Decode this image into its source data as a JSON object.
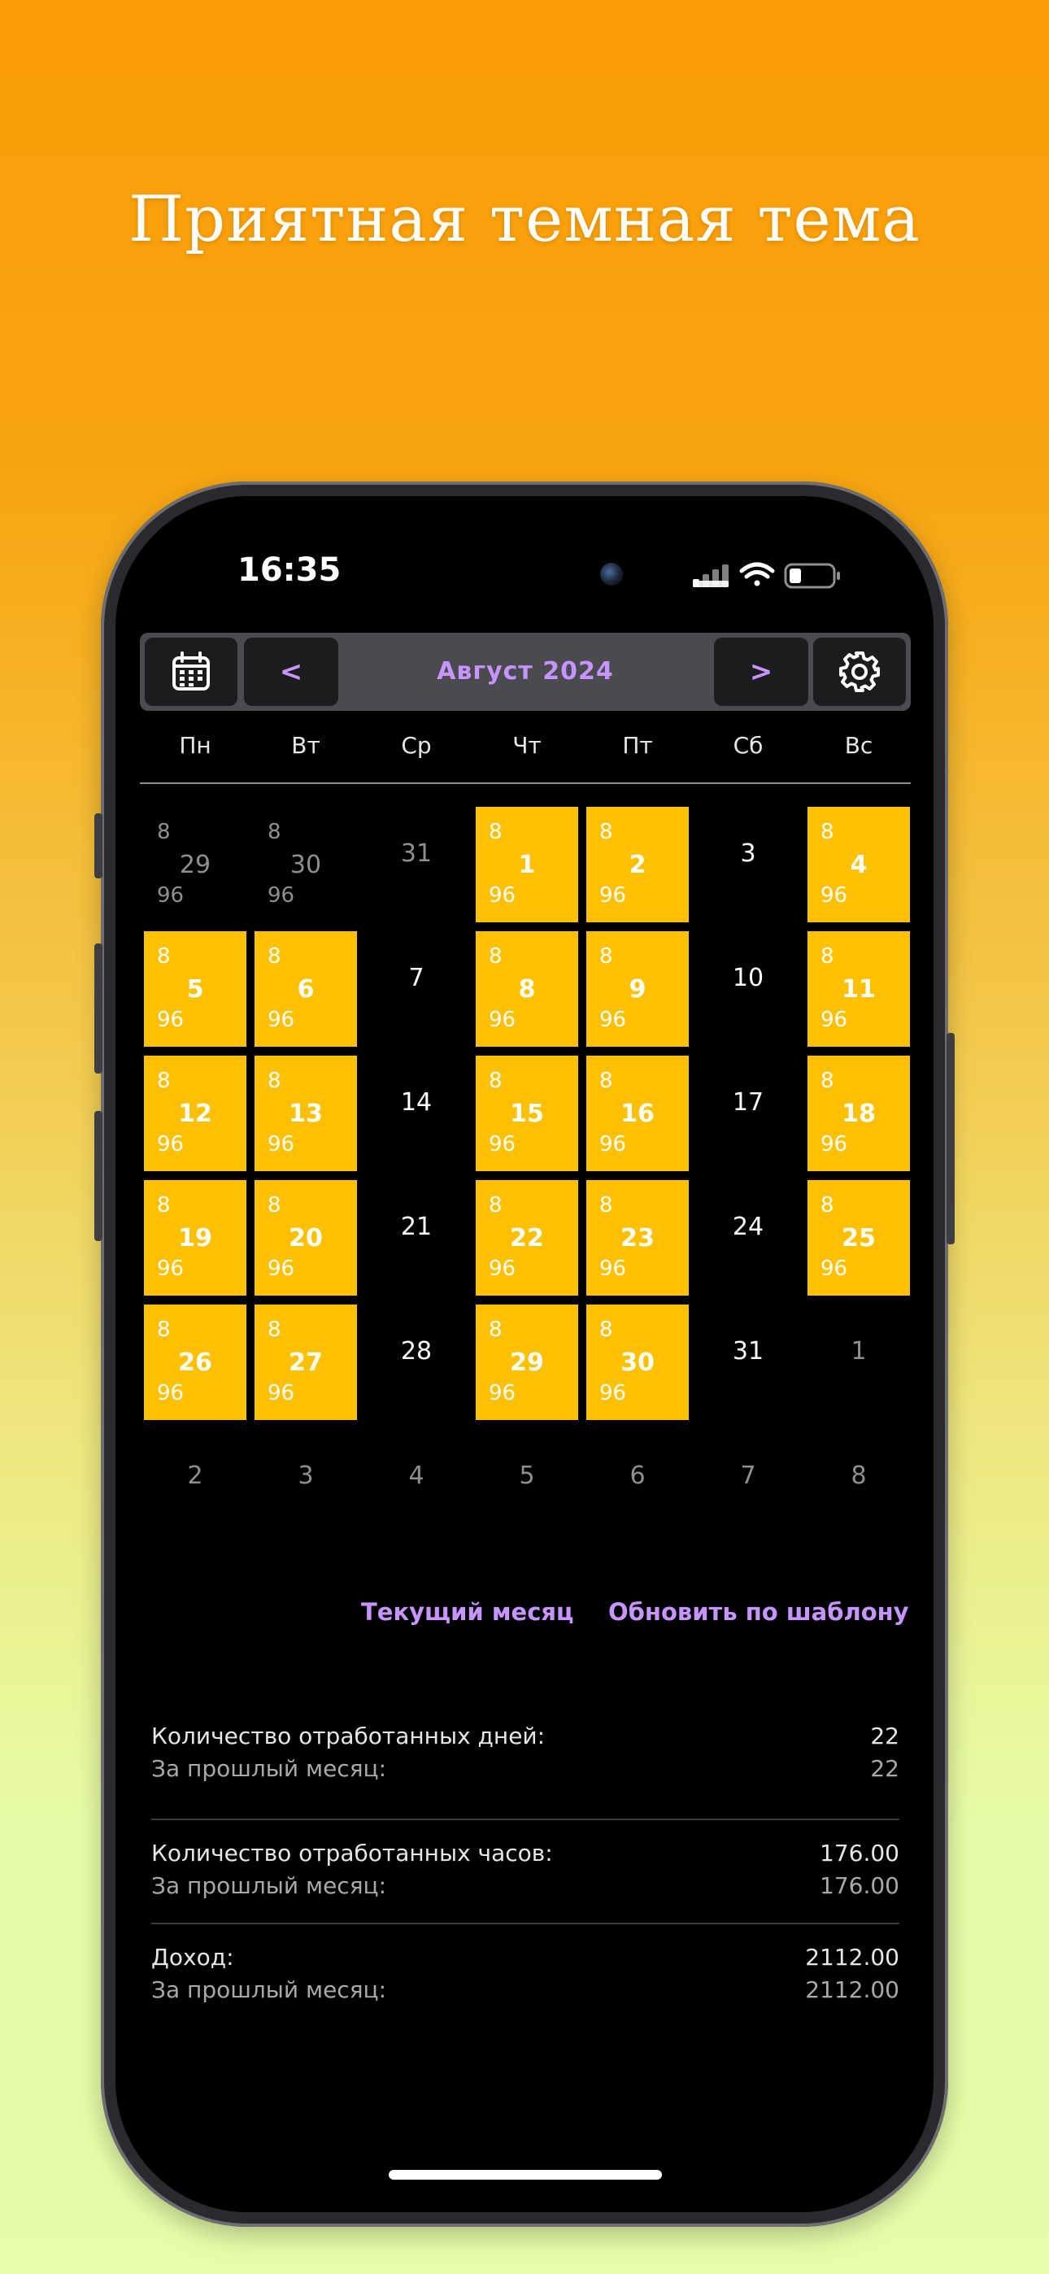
{
  "headline": "Приятная темная тема",
  "status_bar": {
    "time": "16:35"
  },
  "toolbar": {
    "calendar_icon": "calendar-icon",
    "prev_label": "<",
    "month_title": "Август  2024",
    "next_label": ">",
    "settings_icon": "gear-icon"
  },
  "weekdays": [
    "Пн",
    "Вт",
    "Ср",
    "Чт",
    "Пт",
    "Сб",
    "Вс"
  ],
  "calendar": {
    "cells": [
      {
        "day": "29",
        "hrs": "8",
        "pay": "96",
        "kind": "muted"
      },
      {
        "day": "30",
        "hrs": "8",
        "pay": "96",
        "kind": "muted"
      },
      {
        "day": "31",
        "hrs": "",
        "pay": "",
        "kind": "muted"
      },
      {
        "day": "1",
        "hrs": "8",
        "pay": "96",
        "kind": "work"
      },
      {
        "day": "2",
        "hrs": "8",
        "pay": "96",
        "kind": "work"
      },
      {
        "day": "3",
        "hrs": "",
        "pay": "",
        "kind": "plain"
      },
      {
        "day": "4",
        "hrs": "8",
        "pay": "96",
        "kind": "work"
      },
      {
        "day": "5",
        "hrs": "8",
        "pay": "96",
        "kind": "work"
      },
      {
        "day": "6",
        "hrs": "8",
        "pay": "96",
        "kind": "work"
      },
      {
        "day": "7",
        "hrs": "",
        "pay": "",
        "kind": "plain"
      },
      {
        "day": "8",
        "hrs": "8",
        "pay": "96",
        "kind": "work"
      },
      {
        "day": "9",
        "hrs": "8",
        "pay": "96",
        "kind": "work"
      },
      {
        "day": "10",
        "hrs": "",
        "pay": "",
        "kind": "plain"
      },
      {
        "day": "11",
        "hrs": "8",
        "pay": "96",
        "kind": "work"
      },
      {
        "day": "12",
        "hrs": "8",
        "pay": "96",
        "kind": "work"
      },
      {
        "day": "13",
        "hrs": "8",
        "pay": "96",
        "kind": "work"
      },
      {
        "day": "14",
        "hrs": "",
        "pay": "",
        "kind": "plain"
      },
      {
        "day": "15",
        "hrs": "8",
        "pay": "96",
        "kind": "work"
      },
      {
        "day": "16",
        "hrs": "8",
        "pay": "96",
        "kind": "work"
      },
      {
        "day": "17",
        "hrs": "",
        "pay": "",
        "kind": "plain"
      },
      {
        "day": "18",
        "hrs": "8",
        "pay": "96",
        "kind": "work"
      },
      {
        "day": "19",
        "hrs": "8",
        "pay": "96",
        "kind": "work"
      },
      {
        "day": "20",
        "hrs": "8",
        "pay": "96",
        "kind": "work"
      },
      {
        "day": "21",
        "hrs": "",
        "pay": "",
        "kind": "plain"
      },
      {
        "day": "22",
        "hrs": "8",
        "pay": "96",
        "kind": "work"
      },
      {
        "day": "23",
        "hrs": "8",
        "pay": "96",
        "kind": "work"
      },
      {
        "day": "24",
        "hrs": "",
        "pay": "",
        "kind": "plain"
      },
      {
        "day": "25",
        "hrs": "8",
        "pay": "96",
        "kind": "work"
      },
      {
        "day": "26",
        "hrs": "8",
        "pay": "96",
        "kind": "work"
      },
      {
        "day": "27",
        "hrs": "8",
        "pay": "96",
        "kind": "work"
      },
      {
        "day": "28",
        "hrs": "",
        "pay": "",
        "kind": "plain"
      },
      {
        "day": "29",
        "hrs": "8",
        "pay": "96",
        "kind": "work"
      },
      {
        "day": "30",
        "hrs": "8",
        "pay": "96",
        "kind": "work"
      },
      {
        "day": "31",
        "hrs": "",
        "pay": "",
        "kind": "plain"
      },
      {
        "day": "1",
        "hrs": "",
        "pay": "",
        "kind": "muted"
      },
      {
        "day": "2",
        "hrs": "",
        "pay": "",
        "kind": "muted"
      },
      {
        "day": "3",
        "hrs": "",
        "pay": "",
        "kind": "muted"
      },
      {
        "day": "4",
        "hrs": "",
        "pay": "",
        "kind": "muted"
      },
      {
        "day": "5",
        "hrs": "",
        "pay": "",
        "kind": "muted"
      },
      {
        "day": "6",
        "hrs": "",
        "pay": "",
        "kind": "muted"
      },
      {
        "day": "7",
        "hrs": "",
        "pay": "",
        "kind": "muted"
      },
      {
        "day": "8",
        "hrs": "",
        "pay": "",
        "kind": "muted"
      }
    ]
  },
  "actions": {
    "current_month": "Текущий месяц",
    "update_template": "Обновить по шаблону"
  },
  "stats": [
    {
      "label": "Количество отработанных дней:",
      "value": "22",
      "sub_label": "За прошлый месяц:",
      "sub_value": "22"
    },
    {
      "label": "Количество отработанных часов:",
      "value": "176.00",
      "sub_label": "За прошлый месяц:",
      "sub_value": "176.00"
    },
    {
      "label": "Доход:",
      "value": "2112.00",
      "sub_label": "За прошлый месяц:",
      "sub_value": "2112.00"
    }
  ],
  "colors": {
    "accent": "#c695ff",
    "work_day": "#fec000",
    "screen_bg": "#000000",
    "toolbar_bg": "#4a4a4f",
    "button_bg": "#1c1c1e"
  }
}
